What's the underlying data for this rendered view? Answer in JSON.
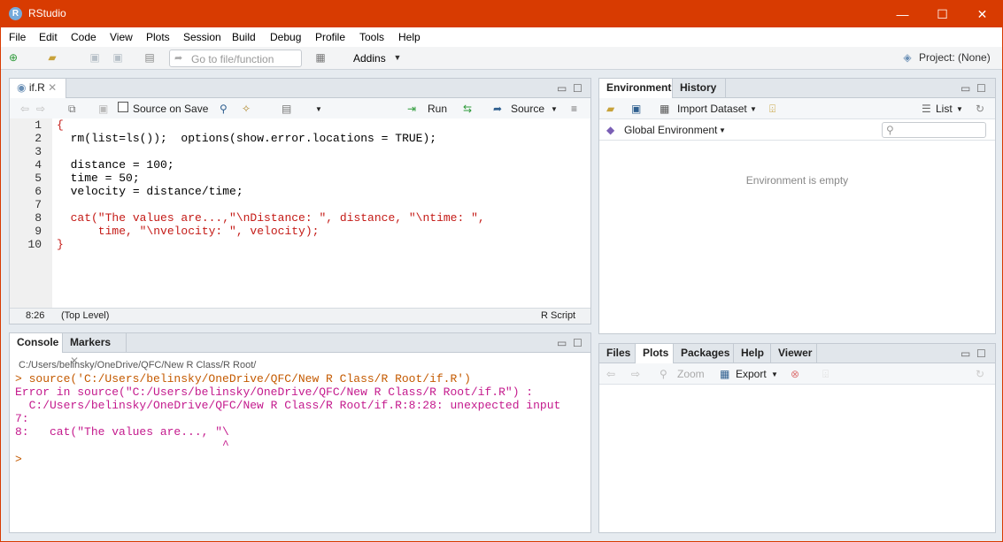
{
  "window": {
    "title": "RStudio",
    "controls": {
      "minimize": "—",
      "maximize": "☐",
      "close": "✕"
    }
  },
  "menu": [
    "File",
    "Edit",
    "Code",
    "View",
    "Plots",
    "Session",
    "Build",
    "Debug",
    "Profile",
    "Tools",
    "Help"
  ],
  "toolbar": {
    "goto_placeholder": "Go to file/function",
    "addins_label": "Addins",
    "project_label": "Project: (None)"
  },
  "source_pane": {
    "tab_label": "if.R",
    "source_on_save": "Source on Save",
    "run_label": "Run",
    "source_label": "Source",
    "code_lines": [
      {
        "n": "1",
        "text": "{"
      },
      {
        "n": "2",
        "text": "  rm(list=ls());  options(show.error.locations = TRUE);"
      },
      {
        "n": "3",
        "text": ""
      },
      {
        "n": "4",
        "text": "  distance = 100;"
      },
      {
        "n": "5",
        "text": "  time = 50;"
      },
      {
        "n": "6",
        "text": "  velocity = distance/time;"
      },
      {
        "n": "7",
        "text": ""
      },
      {
        "n": "8",
        "text": "  cat(\"The values are...,\"\\nDistance: \", distance, \"\\ntime: \","
      },
      {
        "n": "9",
        "text": "      time, \"\\nvelocity: \", velocity);"
      },
      {
        "n": "10",
        "text": "}"
      }
    ],
    "status": {
      "position": "8:26",
      "scope": "(Top Level)",
      "filetype": "R Script"
    }
  },
  "console_pane": {
    "tabs": [
      "Console",
      "Markers"
    ],
    "path": "C:/Users/belinsky/OneDrive/QFC/New R Class/R Root/",
    "lines": [
      "> source('C:/Users/belinsky/OneDrive/QFC/New R Class/R Root/if.R')",
      "Error in source(\"C:/Users/belinsky/OneDrive/QFC/New R Class/R Root/if.R\") :",
      "  C:/Users/belinsky/OneDrive/QFC/New R Class/R Root/if.R:8:28: unexpected input",
      "7:",
      "8:   cat(\"The values are..., \"\\",
      "                              ^",
      "> "
    ]
  },
  "env_pane": {
    "tabs": [
      "Environment",
      "History"
    ],
    "import_label": "Import Dataset",
    "list_label": "List",
    "scope_label": "Global Environment",
    "empty_text": "Environment is empty"
  },
  "files_pane": {
    "tabs": [
      "Files",
      "Plots",
      "Packages",
      "Help",
      "Viewer"
    ],
    "zoom_label": "Zoom",
    "export_label": "Export"
  },
  "colors": {
    "titlebar": "#d83b01",
    "error": "#c41a8d",
    "console_cmd": "#c45a00"
  }
}
